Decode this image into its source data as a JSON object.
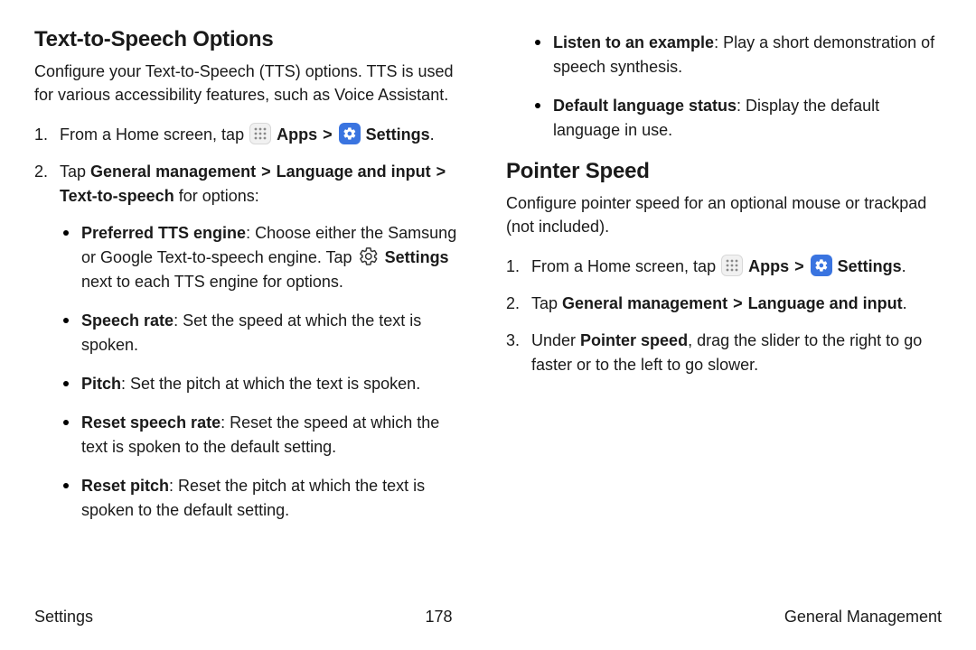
{
  "left": {
    "heading": "Text-to-Speech Options",
    "intro": "Configure your Text-to-Speech (TTS) options. TTS is used for various accessibility features, such as Voice Assistant.",
    "step1_pre": "From a Home screen, tap ",
    "apps_label": "Apps",
    "chev": ">",
    "settings_label": "Settings",
    "step1_post": ".",
    "step2_pre": "Tap ",
    "gm": "General management",
    "li": "Language and input",
    "tts": "Text-to-speech",
    "step2_post": " for options:",
    "b1_title": "Preferred TTS engine",
    "b1_body1": ": Choose either the Samsung or Google Text-to-speech engine. Tap ",
    "b1_settings": "Settings",
    "b1_body2": " next to each TTS engine for options.",
    "b2_title": "Speech rate",
    "b2_body": ": Set the speed at which the text is spoken.",
    "b3_title": "Pitch",
    "b3_body": ": Set the pitch at which the text is spoken.",
    "b4_title": "Reset speech rate",
    "b4_body": ": Reset the speed at which the text is spoken to the default setting.",
    "b5_title": "Reset pitch",
    "b5_body": ": Reset the pitch at which the text is spoken to the default setting."
  },
  "right": {
    "b6_title": "Listen to an example",
    "b6_body": ": Play a short demonstration of speech synthesis.",
    "b7_title": "Default language status",
    "b7_body": ": Display the default language in use.",
    "heading": "Pointer Speed",
    "intro": "Configure pointer speed for an optional mouse or trackpad (not included).",
    "step1_pre": "From a Home screen, tap ",
    "apps_label": "Apps",
    "chev": ">",
    "settings_label": "Settings",
    "step1_post": ".",
    "step2_pre": "Tap ",
    "gm": "General management",
    "li": "Language and input",
    "step2_post": ".",
    "step3_pre": "Under ",
    "ps": "Pointer speed",
    "step3_post": ", drag the slider to the right to go faster or to the left to go slower."
  },
  "footer": {
    "left": "Settings",
    "page": "178",
    "right": "General Management"
  }
}
